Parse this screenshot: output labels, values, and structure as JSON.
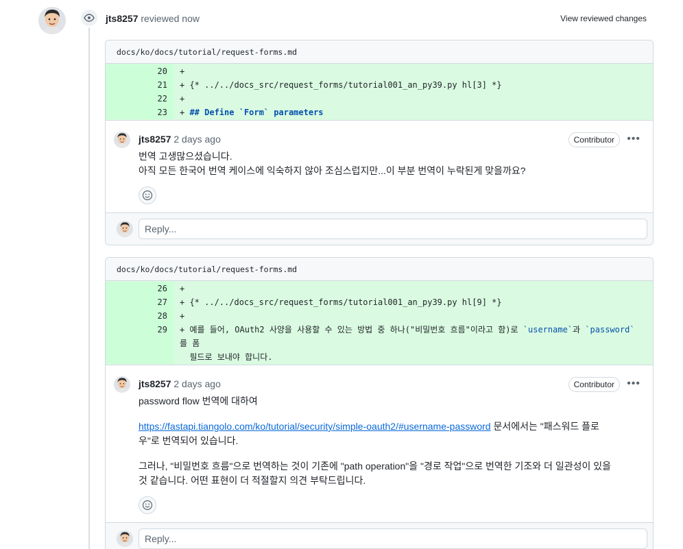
{
  "review": {
    "user": "jts8257",
    "action": "reviewed now",
    "view_changes_label": "View reviewed changes"
  },
  "threads": [
    {
      "file": "docs/ko/docs/tutorial/request-forms.md",
      "diff": [
        {
          "num": "20",
          "code": "+"
        },
        {
          "num": "21",
          "code": "+ {* ../../docs_src/request_forms/tutorial001_an_py39.py hl[3] *}"
        },
        {
          "num": "22",
          "code": "+"
        },
        {
          "num": "23",
          "prefix": "+ ",
          "code": "## Define `Form` parameters"
        }
      ],
      "comment": {
        "user": "jts8257",
        "time": "2 days ago",
        "badge": "Contributor",
        "line1": "번역 고생많으셨습니다.",
        "line2": "아직 모든 한국어 번역 케이스에 익숙하지 않아 조심스럽지만...이 부분 번역이 누락된게 맞을까요?"
      },
      "reply_placeholder": "Reply..."
    },
    {
      "file": "docs/ko/docs/tutorial/request-forms.md",
      "diff": [
        {
          "num": "26",
          "code": "+"
        },
        {
          "num": "27",
          "code": "+ {* ../../docs_src/request_forms/tutorial001_an_py39.py hl[9] *}"
        },
        {
          "num": "28",
          "code": "+"
        },
        {
          "num": "29",
          "pre": "+ 예를 들어, OAuth2 사양을 사용할 수 있는 방법 중 하나(\"비밀번호 흐름\"이라고 함)로 ",
          "var1": "`username`",
          "mid": "과 ",
          "var2": "`password`",
          "post": "를 폼\n  필드로 보내야 합니다."
        }
      ],
      "comment": {
        "user": "jts8257",
        "time": "2 days ago",
        "badge": "Contributor",
        "p1": "password flow 번역에 대하여",
        "link": "https://fastapi.tiangolo.com/ko/tutorial/security/simple-oauth2/#username-password",
        "p2_after_link": " 문서에서는 \"패스워드 플로우\"로 번역되어 있습니다.",
        "p3": "그러나, \"비밀번호 흐름\"으로 번역하는 것이 기존에 \"path operation\"을 \"경로 작업\"으로 번역한 기조와 더 일관성이 있을 것 같습니다. 어떤 표현이 더 적절할지 의견 부탁드립니다."
      },
      "reply_placeholder": "Reply..."
    }
  ]
}
